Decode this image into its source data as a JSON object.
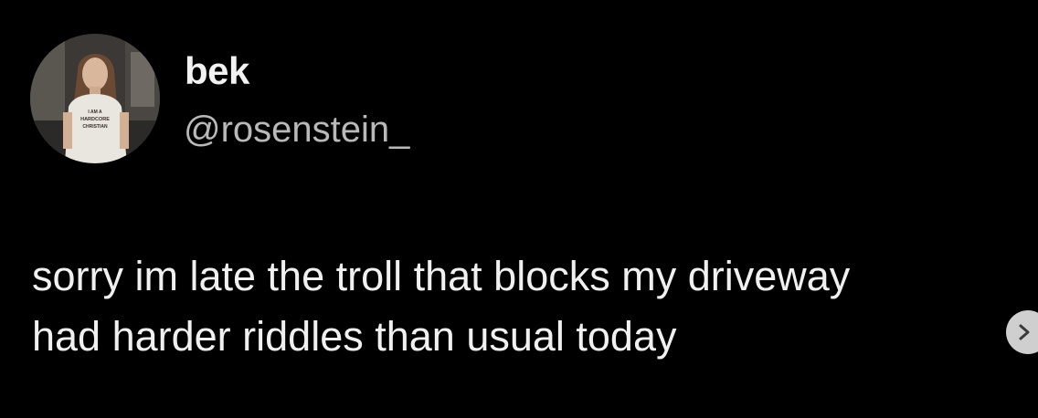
{
  "author": {
    "display_name": "bek",
    "handle": "@rosenstein_"
  },
  "tweet": {
    "lines": [
      "sorry im late the troll that blocks my driveway",
      "had harder riddles than usual today"
    ]
  },
  "avatar_shirt_text": [
    "I AM A",
    "HARDCORE",
    "CHRISTIAN"
  ],
  "icons": {
    "next": "chevron-right-icon"
  },
  "colors": {
    "background": "#000000",
    "display_name": "#f2f2f2",
    "handle": "#b9b9b9",
    "text": "#f0f0f0",
    "next_button": "#cfcfcf"
  }
}
